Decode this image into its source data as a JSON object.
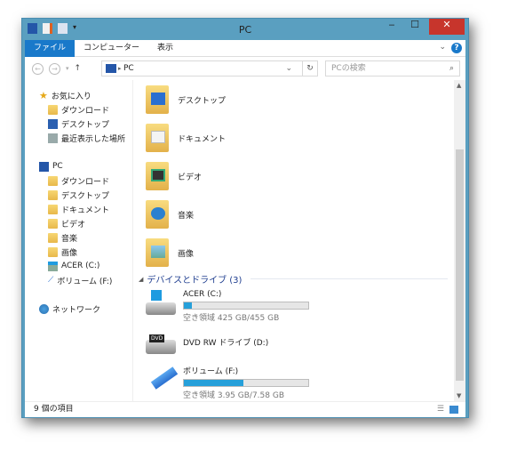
{
  "window": {
    "title": "PC",
    "minimize": "‒",
    "maximize": "☐",
    "close": "✕"
  },
  "ribbon": {
    "tabs": [
      "ファイル",
      "コンピューター",
      "表示"
    ],
    "help": "?"
  },
  "nav": {
    "address": "PC",
    "search_placeholder": "PCの検索"
  },
  "sidebar": {
    "favorites": {
      "label": "お気に入り",
      "items": [
        "ダウンロード",
        "デスクトップ",
        "最近表示した場所"
      ]
    },
    "pc": {
      "label": "PC",
      "items": [
        "ダウンロード",
        "デスクトップ",
        "ドキュメント",
        "ビデオ",
        "音楽",
        "画像",
        "ACER (C:)",
        "ボリューム (F:)"
      ]
    },
    "network": "ネットワーク"
  },
  "folders": [
    "デスクトップ",
    "ドキュメント",
    "ビデオ",
    "音楽",
    "画像"
  ],
  "devices": {
    "header": "デバイスとドライブ (3)",
    "drives": [
      {
        "name": "ACER (C:)",
        "free": "空き領域 425 GB/455 GB",
        "used_percent": 6.6
      },
      {
        "name": "DVD RW ドライブ (D:)"
      },
      {
        "name": "ボリューム (F:)",
        "free": "空き領域 3.95 GB/7.58 GB",
        "used_percent": 47.9
      }
    ]
  },
  "status": {
    "count": "9 個の項目"
  },
  "colors": {
    "accent": "#1979ca",
    "titlebar": "#5a9fc0",
    "close": "#c7352c",
    "bar": "#26a0da"
  }
}
